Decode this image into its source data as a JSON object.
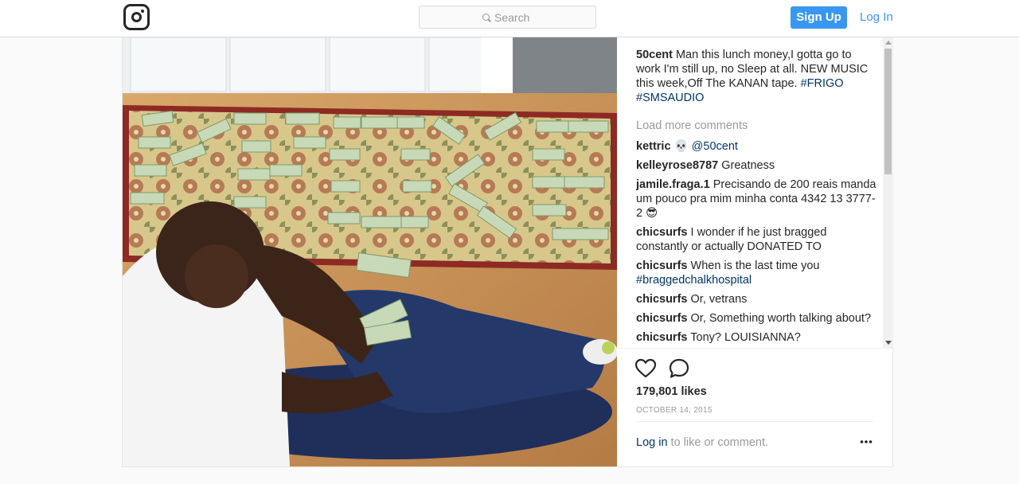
{
  "header": {
    "logo_icon": "instagram-camera-icon",
    "search_placeholder": "Search",
    "signup_label": "Sign Up",
    "login_label": "Log In"
  },
  "post": {
    "caption": {
      "user": "50cent",
      "text": " Man this lunch money,I gotta go to work I'm still up, no Sleep at all. NEW MUSIC this week,Off The KANAN tape. ",
      "tags": [
        "#FRIGO",
        "#SMSAUDIO"
      ]
    },
    "load_more": "Load more comments",
    "comments": [
      {
        "user": "kettric",
        "text": " 💀 ",
        "mention": "@50cent"
      },
      {
        "user": "kelleyrose8787",
        "text": " Greatness"
      },
      {
        "user": "jamile.fraga.1",
        "text": " Precisando de 200 reais manda um pouco pra mim minha conta 4342 13 3777-2 😎"
      },
      {
        "user": "chicsurfs",
        "text": " I wonder if he just bragged constantly or actually DONATED TO"
      },
      {
        "user": "chicsurfs",
        "text": " When is the last time you ",
        "hashtag": "#braggedchalkhospital"
      },
      {
        "user": "chicsurfs",
        "text": " Or, vetrans"
      },
      {
        "user": "chicsurfs",
        "text": " Or, Something worth talking about?"
      },
      {
        "user": "chicsurfs",
        "text": " Tony? LOUISIANNA?"
      }
    ],
    "likes": "179,801 likes",
    "date": "OCTOBER 14, 2015",
    "login_link": "Log in",
    "login_suffix": " to like or comment.",
    "icons": {
      "like": "heart-icon",
      "comment": "comment-bubble-icon",
      "more": "more-options-icon"
    },
    "photo_alt": "man-seated-beside-cash-photo"
  }
}
